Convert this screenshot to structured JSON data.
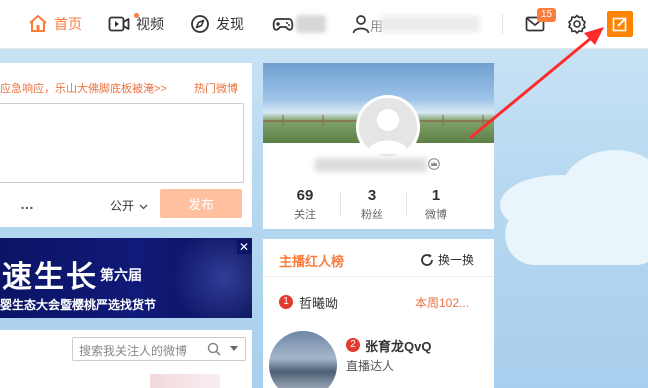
{
  "nav": {
    "home_label": "首页",
    "video_label": "视频",
    "discover_label": "发现",
    "user_name_partial": "用",
    "messages_badge": "15"
  },
  "composer": {
    "hot_line": "应急响应，乐山大佛脚底板被淹>>",
    "hot_topic_link": "热门微博",
    "more_icon": "…",
    "visibility": "公开",
    "publish_label": "发布"
  },
  "banner": {
    "headline": "速生长",
    "edition": "第六届",
    "subtitle": "婴生态大会暨樱桃严选找货节",
    "close_label": "✕"
  },
  "feed_search": {
    "placeholder": "搜索我关注人的微博"
  },
  "profile": {
    "stats": [
      {
        "value": "69",
        "label": "关注"
      },
      {
        "value": "3",
        "label": "粉丝"
      },
      {
        "value": "1",
        "label": "微博"
      }
    ]
  },
  "hot_list": {
    "title": "主播红人榜",
    "refresh_label": "换一换",
    "items": [
      {
        "rank": "1",
        "name": "哲曦呦",
        "extra": "本周102..."
      },
      {
        "rank": "2",
        "name": "张育龙QvQ",
        "subtitle": "直播达人"
      }
    ]
  },
  "colors": {
    "accent": "#fa7d3c",
    "compose_button": "#ff8200",
    "publish_disabled": "#ffc09f",
    "annotation_arrow": "#ff2b2b"
  }
}
